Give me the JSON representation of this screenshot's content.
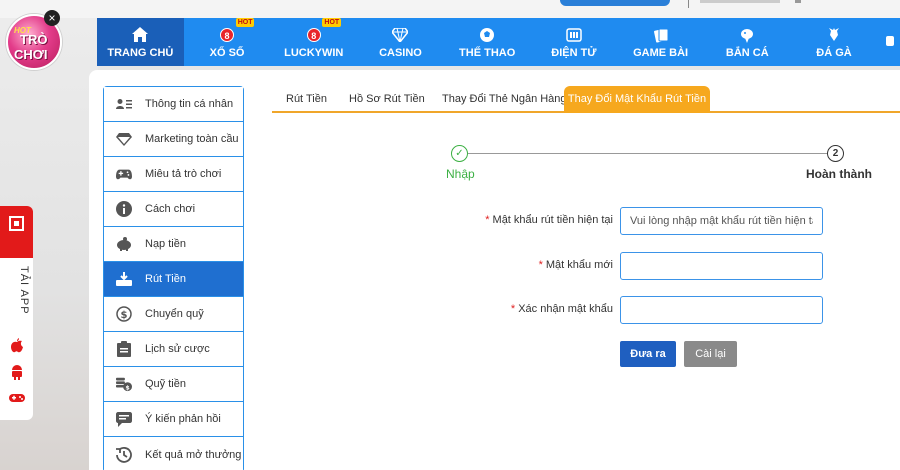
{
  "logo": {
    "hot": "HOT",
    "line1": "TRÒ",
    "line2": "CHƠI"
  },
  "nav": {
    "items": [
      {
        "label": "TRANG CHỦ",
        "icon": "home-icon",
        "active": true
      },
      {
        "label": "XỔ SỐ",
        "icon": "lottery-ball-icon",
        "badge": "HOT",
        "ball": "8"
      },
      {
        "label": "LUCKYWIN",
        "icon": "lottery-ball-icon",
        "badge": "HOT",
        "ball": "8"
      },
      {
        "label": "CASINO",
        "icon": "diamond-icon"
      },
      {
        "label": "THỂ THAO",
        "icon": "soccer-ball-icon"
      },
      {
        "label": "ĐIỆN TỬ",
        "icon": "slot-machine-icon"
      },
      {
        "label": "GAME BÀI",
        "icon": "cards-icon"
      },
      {
        "label": "BẮN CÁ",
        "icon": "fish-icon"
      },
      {
        "label": "ĐÁ GÀ",
        "icon": "rooster-icon"
      }
    ]
  },
  "appbar": {
    "label": "TẢI APP"
  },
  "sidebar": {
    "items": [
      {
        "label": "Thông tin cá nhân",
        "icon": "id-card-icon"
      },
      {
        "label": "Marketing toàn cầu",
        "icon": "diamond-icon"
      },
      {
        "label": "Miêu tả trò chơi",
        "icon": "gamepad-icon"
      },
      {
        "label": "Cách chơi",
        "icon": "info-icon"
      },
      {
        "label": "Nạp tiền",
        "icon": "piggy-bank-icon"
      },
      {
        "label": "Rút Tiền",
        "icon": "withdraw-icon",
        "active": true
      },
      {
        "label": "Chuyển quỹ",
        "icon": "dollar-circle-icon"
      },
      {
        "label": "Lịch sử cược",
        "icon": "clipboard-icon"
      },
      {
        "label": "Quỹ tiền",
        "icon": "coins-icon"
      },
      {
        "label": "Ý kiến phản hồi",
        "icon": "chat-bubble-icon"
      },
      {
        "label": "Kết quả mở thưởng",
        "icon": "history-icon"
      }
    ]
  },
  "tabs": [
    {
      "label": "Rút Tiền"
    },
    {
      "label": "Hồ Sơ Rút Tiền"
    },
    {
      "label": "Thay Đổi Thẻ Ngân Hàng"
    },
    {
      "label": "Thay Đổi Mật Khẩu Rút Tiền",
      "active": true
    }
  ],
  "stepper": {
    "step1": {
      "label": "Nhập",
      "mark": "✓"
    },
    "step2": {
      "label": "Hoàn thành",
      "number": "2"
    }
  },
  "form": {
    "required_mark": "*",
    "current": {
      "label": "Mật khẩu rút tiền hiện tại",
      "placeholder": "Vui lòng nhập mật khẩu rút tiền hiện tại",
      "value": ""
    },
    "new": {
      "label": "Mật khẩu mới",
      "placeholder": "",
      "value": ""
    },
    "confirm": {
      "label": "Xác nhận mật khẩu",
      "placeholder": "",
      "value": ""
    },
    "submit_label": "Đưa ra",
    "reset_label": "Cài lại"
  },
  "colors": {
    "nav_bg": "#1f8bf0",
    "nav_active": "#1a5fb8",
    "tab_active": "#f6a81e",
    "sidebar_active": "#1f6fd0",
    "step_done": "#3cb043",
    "required": "#e02020",
    "submit": "#1f5fc0",
    "reset": "#8a8a8a"
  }
}
